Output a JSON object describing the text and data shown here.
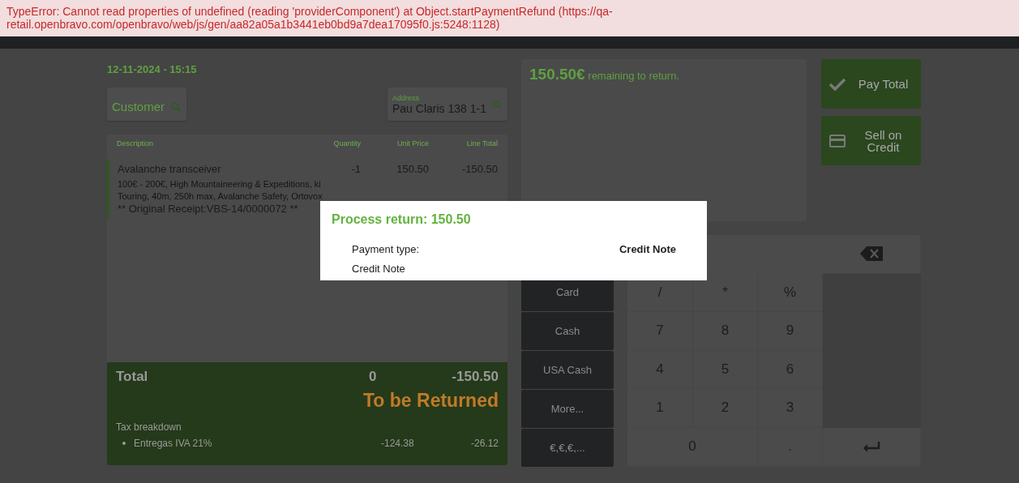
{
  "error_banner": {
    "message": "TypeError: Cannot read properties of undefined (reading 'providerComponent') at Object.startPaymentRefund (https://qa-retail.openbravo.com/openbravo/web/js/gen/aa82a05a1b3441eb0bd9a7dea17095f0.js:5248:1128)"
  },
  "receipt": {
    "date": "12-11-2024 - 15:15",
    "customer": {
      "placeholder": "Customer"
    },
    "address": {
      "label": "Address",
      "value": "Pau Claris 138 1-1"
    },
    "columns": [
      "Description",
      "Quantity",
      "Unit Price",
      "Line Total"
    ],
    "lines": [
      {
        "description": "Avalanche transceiver",
        "quantity": "-1",
        "unit_price": "150.50",
        "line_total": "-150.50",
        "attributes": "100€ - 200€, High Mountaineering & Expeditions, ki Touring, 40m, 250h max, Avalanche Safety, Ortovox",
        "note": "** Original Receipt:VBS-14/0000072 **",
        "selected": true
      }
    ],
    "total": {
      "label": "Total",
      "quantity": "0",
      "amount": "-150.50",
      "status": "To be Returned"
    },
    "tax_breakdown": {
      "title": "Tax breakdown",
      "lines": [
        {
          "name": "Entregas IVA 21%",
          "base": "-124.38",
          "tax": "-26.12"
        }
      ]
    }
  },
  "payment": {
    "amount": "150.50€",
    "remaining": "remaining to return."
  },
  "actions": [
    {
      "label": "Pay Total",
      "kind": "check"
    },
    {
      "label": "Sell on Credit",
      "kind": "card"
    }
  ],
  "payment_methods": [
    "Card",
    "Cash",
    "USA Cash",
    "More...",
    "€,€,€,..."
  ],
  "keypad": {
    "rows": [
      [
        "/",
        "*",
        "%"
      ],
      [
        "7",
        "8",
        "9"
      ],
      [
        "4",
        "5",
        "6"
      ],
      [
        "1",
        "2",
        "3"
      ]
    ],
    "bottom": [
      {
        "label": "0",
        "kind": "wide"
      },
      {
        "label": ".",
        "kind": "key"
      }
    ]
  },
  "dialog": {
    "title": "Process return: 150.50",
    "field_label": "Payment type:",
    "field_value": "Credit Note",
    "method": "Credit Note"
  }
}
